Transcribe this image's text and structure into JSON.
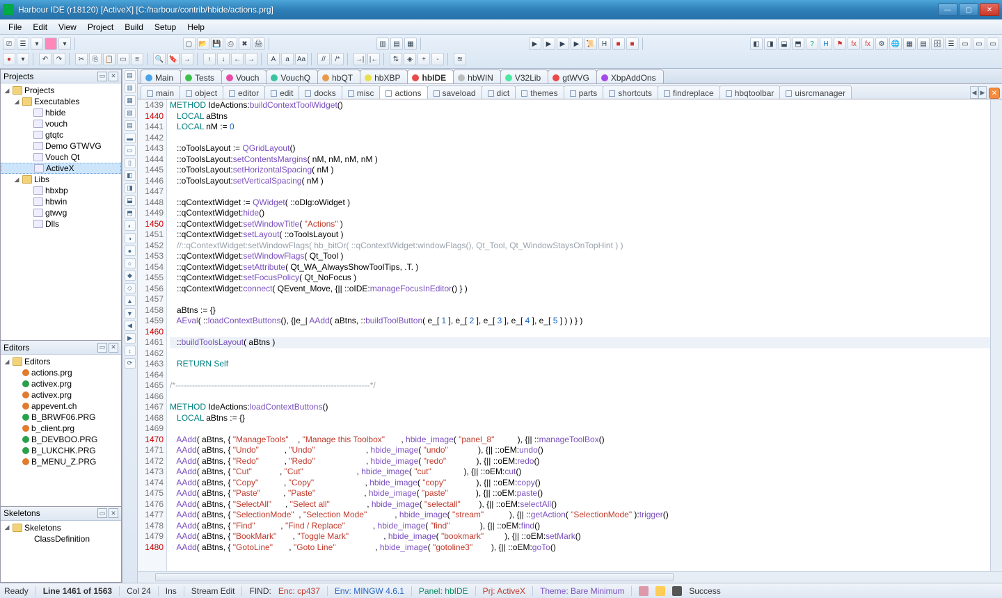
{
  "window": {
    "title": "Harbour IDE (r18120) [ActiveX]  [C:/harbour/contrib/hbide/actions.prg]"
  },
  "menus": [
    "File",
    "Edit",
    "View",
    "Project",
    "Build",
    "Setup",
    "Help"
  ],
  "projects": {
    "title": "Projects",
    "root": "Projects",
    "executables": "Executables",
    "exec_items": [
      "hbide",
      "vouch",
      "gtqtc",
      "Demo GTWVG",
      "Vouch Qt",
      "ActiveX"
    ],
    "selected_exec": "ActiveX",
    "libs": "Libs",
    "lib_items": [
      "hbxbp",
      "hbwin",
      "gtwvg",
      "Dlls"
    ]
  },
  "editors": {
    "title": "Editors",
    "root": "Editors",
    "items": [
      {
        "color": "#e07b2f",
        "name": "actions.prg"
      },
      {
        "color": "#2aa04a",
        "name": "activex.prg"
      },
      {
        "color": "#e07b2f",
        "name": "activex.prg"
      },
      {
        "color": "#e07b2f",
        "name": "appevent.ch"
      },
      {
        "color": "#2aa04a",
        "name": "B_BRWF06.PRG"
      },
      {
        "color": "#e07b2f",
        "name": "b_client.prg"
      },
      {
        "color": "#2aa04a",
        "name": "B_DEVBOO.PRG"
      },
      {
        "color": "#2aa04a",
        "name": "B_LUKCHK.PRG"
      },
      {
        "color": "#e07b2f",
        "name": "B_MENU_Z.PRG"
      }
    ]
  },
  "skeletons": {
    "title": "Skeletons",
    "root": "Skeletons",
    "items": [
      "ClassDefinition"
    ]
  },
  "main_tabs": [
    {
      "color": "#4aa3e8",
      "label": "Main"
    },
    {
      "color": "#3cc24a",
      "label": "Tests"
    },
    {
      "color": "#e84aa3",
      "label": "Vouch"
    },
    {
      "color": "#3cc2a0",
      "label": "VouchQ"
    },
    {
      "color": "#e89a4a",
      "label": "hbQT"
    },
    {
      "color": "#e8e04a",
      "label": "hbXBP"
    },
    {
      "color": "#e84a4a",
      "label": "hbIDE",
      "active": true
    },
    {
      "color": "#bcbcbc",
      "label": "hbWIN"
    },
    {
      "color": "#4ae8a3",
      "label": "V32Lib"
    },
    {
      "color": "#e84a4a",
      "label": "gtWVG"
    },
    {
      "color": "#a34ae8",
      "label": "XbpAddOns"
    }
  ],
  "sub_tabs": [
    "main",
    "object",
    "editor",
    "edit",
    "docks",
    "misc",
    "actions",
    "saveload",
    "dict",
    "themes",
    "parts",
    "shortcuts",
    "findreplace",
    "hbqtoolbar",
    "uisrcmanager"
  ],
  "active_sub_tab": "actions",
  "lines": [
    {
      "n": 1439,
      "mod": false,
      "html": "<span class='kw'>METHOD</span> IdeActions:<span class='fn'>buildContextToolWidget</span>()"
    },
    {
      "n": 1440,
      "mod": true,
      "html": "   <span class='kw'>LOCAL</span> aBtns"
    },
    {
      "n": 1441,
      "mod": false,
      "html": "   <span class='kw'>LOCAL</span> nM := <span class='num'>0</span>"
    },
    {
      "n": 1442,
      "mod": false,
      "html": ""
    },
    {
      "n": 1443,
      "mod": false,
      "html": "   ::oToolsLayout := <span class='fn'>QGridLayout</span>()"
    },
    {
      "n": 1444,
      "mod": false,
      "html": "   ::oToolsLayout:<span class='fn'>setContentsMargins</span>( nM, nM, nM, nM )"
    },
    {
      "n": 1445,
      "mod": false,
      "html": "   ::oToolsLayout:<span class='fn'>setHorizontalSpacing</span>( nM )"
    },
    {
      "n": 1446,
      "mod": false,
      "html": "   ::oToolsLayout:<span class='fn'>setVerticalSpacing</span>( nM )"
    },
    {
      "n": 1447,
      "mod": false,
      "html": ""
    },
    {
      "n": 1448,
      "mod": false,
      "html": "   ::qContextWidget := <span class='fn'>QWidget</span>( ::oDlg:oWidget )"
    },
    {
      "n": 1449,
      "mod": false,
      "html": "   ::qContextWidget:<span class='fn'>hide</span>()"
    },
    {
      "n": 1450,
      "mod": true,
      "html": "   ::qContextWidget:<span class='fn'>setWindowTitle</span>( <span class='str'>\"Actions\"</span> )"
    },
    {
      "n": 1451,
      "mod": false,
      "html": "   ::qContextWidget:<span class='fn'>setLayout</span>( ::oToolsLayout )"
    },
    {
      "n": 1452,
      "mod": false,
      "html": "   <span class='cmt'>//::qContextWidget:setWindowFlags( hb_bitOr( ::qContextWidget:windowFlags(), Qt_Tool, Qt_WindowStaysOnTopHint ) )</span>"
    },
    {
      "n": 1453,
      "mod": false,
      "html": "   ::qContextWidget:<span class='fn'>setWindowFlags</span>( Qt_Tool )"
    },
    {
      "n": 1454,
      "mod": false,
      "html": "   ::qContextWidget:<span class='fn'>setAttribute</span>( Qt_WA_AlwaysShowToolTips, .T. )"
    },
    {
      "n": 1455,
      "mod": false,
      "html": "   ::qContextWidget:<span class='fn'>setFocusPolicy</span>( Qt_NoFocus )"
    },
    {
      "n": 1456,
      "mod": false,
      "html": "   ::qContextWidget:<span class='fn'>connect</span>( QEvent_Move, {|| ::oIDE:<span class='fn'>manageFocusInEditor</span>() } )"
    },
    {
      "n": 1457,
      "mod": false,
      "html": ""
    },
    {
      "n": 1458,
      "mod": false,
      "html": "   aBtns := {}"
    },
    {
      "n": 1459,
      "mod": false,
      "html": "   <span class='fn'>AEval</span>( ::<span class='fn'>loadContextButtons</span>(), {|e_| <span class='fn'>AAdd</span>( aBtns, ::<span class='fn'>buildToolButton</span>( e_[ <span class='num'>1</span> ], e_[ <span class='num'>2</span> ], e_[ <span class='num'>3</span> ], e_[ <span class='num'>4</span> ], e_[ <span class='num'>5</span> ] ) ) } )"
    },
    {
      "n": 1460,
      "mod": true,
      "html": ""
    },
    {
      "n": 1461,
      "mod": false,
      "cur": true,
      "html": "   ::<span class='fn'>buildToolsLayout</span>( aBtns )"
    },
    {
      "n": 1462,
      "mod": false,
      "html": ""
    },
    {
      "n": 1463,
      "mod": false,
      "html": "   <span class='kw'>RETURN</span> <span class='kw'>Self</span>"
    },
    {
      "n": 1464,
      "mod": false,
      "html": ""
    },
    {
      "n": 1465,
      "mod": false,
      "html": "<span class='cmt'>/*----------------------------------------------------------------------*/</span>"
    },
    {
      "n": 1466,
      "mod": false,
      "html": ""
    },
    {
      "n": 1467,
      "mod": false,
      "html": "<span class='kw'>METHOD</span> IdeActions:<span class='fn'>loadContextButtons</span>()"
    },
    {
      "n": 1468,
      "mod": false,
      "html": "   <span class='kw'>LOCAL</span> aBtns := {}"
    },
    {
      "n": 1469,
      "mod": false,
      "html": ""
    },
    {
      "n": 1470,
      "mod": true,
      "html": "   <span class='fn'>AAdd</span>( aBtns, { <span class='str'>\"ManageTools\"</span>    , <span class='str'>\"Manage this Toolbox\"</span>       , <span class='fn'>hbide_image</span>( <span class='str'>\"panel_8\"</span>          ), {|| ::<span class='fn'>manageToolBox</span>()"
    },
    {
      "n": 1471,
      "mod": false,
      "html": "   <span class='fn'>AAdd</span>( aBtns, { <span class='str'>\"Undo\"</span>           , <span class='str'>\"Undo\"</span>                      , <span class='fn'>hbide_image</span>( <span class='str'>\"undo\"</span>             ), {|| ::oEM:<span class='fn'>undo</span>()"
    },
    {
      "n": 1472,
      "mod": false,
      "html": "   <span class='fn'>AAdd</span>( aBtns, { <span class='str'>\"Redo\"</span>           , <span class='str'>\"Redo\"</span>                      , <span class='fn'>hbide_image</span>( <span class='str'>\"redo\"</span>             ), {|| ::oEM:<span class='fn'>redo</span>()"
    },
    {
      "n": 1473,
      "mod": false,
      "html": "   <span class='fn'>AAdd</span>( aBtns, { <span class='str'>\"Cut\"</span>            , <span class='str'>\"Cut\"</span>                       , <span class='fn'>hbide_image</span>( <span class='str'>\"cut\"</span>              ), {|| ::oEM:<span class='fn'>cut</span>()"
    },
    {
      "n": 1474,
      "mod": false,
      "html": "   <span class='fn'>AAdd</span>( aBtns, { <span class='str'>\"Copy\"</span>           , <span class='str'>\"Copy\"</span>                      , <span class='fn'>hbide_image</span>( <span class='str'>\"copy\"</span>             ), {|| ::oEM:<span class='fn'>copy</span>()"
    },
    {
      "n": 1475,
      "mod": false,
      "html": "   <span class='fn'>AAdd</span>( aBtns, { <span class='str'>\"Paste\"</span>          , <span class='str'>\"Paste\"</span>                     , <span class='fn'>hbide_image</span>( <span class='str'>\"paste\"</span>            ), {|| ::oEM:<span class='fn'>paste</span>()"
    },
    {
      "n": 1476,
      "mod": false,
      "html": "   <span class='fn'>AAdd</span>( aBtns, { <span class='str'>\"SelectAll\"</span>      , <span class='str'>\"Select all\"</span>                , <span class='fn'>hbide_image</span>( <span class='str'>\"selectall\"</span>        ), {|| ::oEM:<span class='fn'>selectAll</span>()"
    },
    {
      "n": 1477,
      "mod": false,
      "html": "   <span class='fn'>AAdd</span>( aBtns, { <span class='str'>\"SelectionMode\"</span>  , <span class='str'>\"Selection Mode\"</span>            , <span class='fn'>hbide_image</span>( <span class='str'>\"stream\"</span>           ), {|| ::<span class='fn'>getAction</span>( <span class='str'>\"SelectionMode\"</span> ):<span class='fn'>trigger</span>()"
    },
    {
      "n": 1478,
      "mod": false,
      "html": "   <span class='fn'>AAdd</span>( aBtns, { <span class='str'>\"Find\"</span>           , <span class='str'>\"Find / Replace\"</span>            , <span class='fn'>hbide_image</span>( <span class='str'>\"find\"</span>             ), {|| ::oEM:<span class='fn'>find</span>()"
    },
    {
      "n": 1479,
      "mod": false,
      "html": "   <span class='fn'>AAdd</span>( aBtns, { <span class='str'>\"BookMark\"</span>       , <span class='str'>\"Toggle Mark\"</span>               , <span class='fn'>hbide_image</span>( <span class='str'>\"bookmark\"</span>         ), {|| ::oEM:<span class='fn'>setMark</span>()"
    },
    {
      "n": 1480,
      "mod": true,
      "html": "   <span class='fn'>AAdd</span>( aBtns, { <span class='str'>\"GotoLine\"</span>       , <span class='str'>\"Goto Line\"</span>                 , <span class='fn'>hbide_image</span>( <span class='str'>\"gotoline3\"</span>        ), {|| ::oEM:<span class='fn'>goTo</span>()"
    }
  ],
  "status": {
    "ready": "Ready",
    "line": "Line 1461 of 1563",
    "col": "Col 24",
    "ins": "Ins",
    "mode": "Stream Edit",
    "find": "FIND:",
    "enc": "Enc: cp437",
    "env": "Env: MINGW 4.6.1",
    "panel": "Panel: hbIDE",
    "prj": "Prj: ActiveX",
    "theme": "Theme: Bare Minimum",
    "success": "Success"
  }
}
